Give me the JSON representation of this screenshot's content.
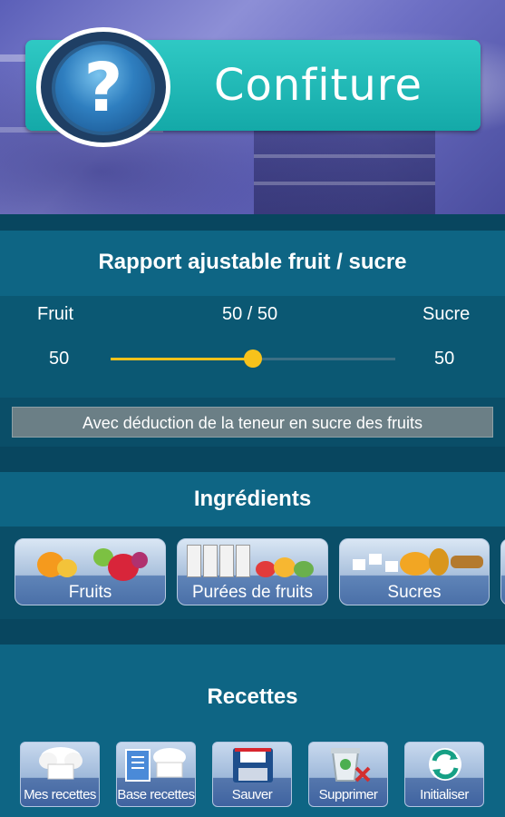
{
  "header": {
    "title": "Confiture",
    "help_symbol": "?",
    "help_icon": "question-mark-icon",
    "colors": {
      "banner": "#1fb8b5",
      "badge": "#2f7fc0"
    }
  },
  "ratio": {
    "section_title": "Rapport ajustable fruit / sucre",
    "fruit_label": "Fruit",
    "sugar_label": "Sucre",
    "ratio_text": "50 / 50",
    "fruit_value": "50",
    "sugar_value": "50",
    "slider_fraction": 0.5,
    "slider_color": "#f7c21b",
    "deduction_text": "Avec déduction de la teneur en sucre des fruits"
  },
  "ingredients": {
    "section_title": "Ingrédients",
    "cards": [
      {
        "label": "Fruits",
        "icon": "fruits-image"
      },
      {
        "label": "Purées de fruits",
        "icon": "fruit-puree-image"
      },
      {
        "label": "Sucres",
        "icon": "sugars-image"
      }
    ]
  },
  "recipes": {
    "section_title": "Recettes",
    "buttons": [
      {
        "label": "Mes recettes",
        "icon": "chef-hat-icon"
      },
      {
        "label": "Base recettes",
        "icon": "recipe-book-icon"
      },
      {
        "label": "Sauver",
        "icon": "save-disk-icon"
      },
      {
        "label": "Supprimer",
        "icon": "delete-bin-icon"
      },
      {
        "label": "Initialiser",
        "icon": "refresh-icon"
      }
    ]
  }
}
